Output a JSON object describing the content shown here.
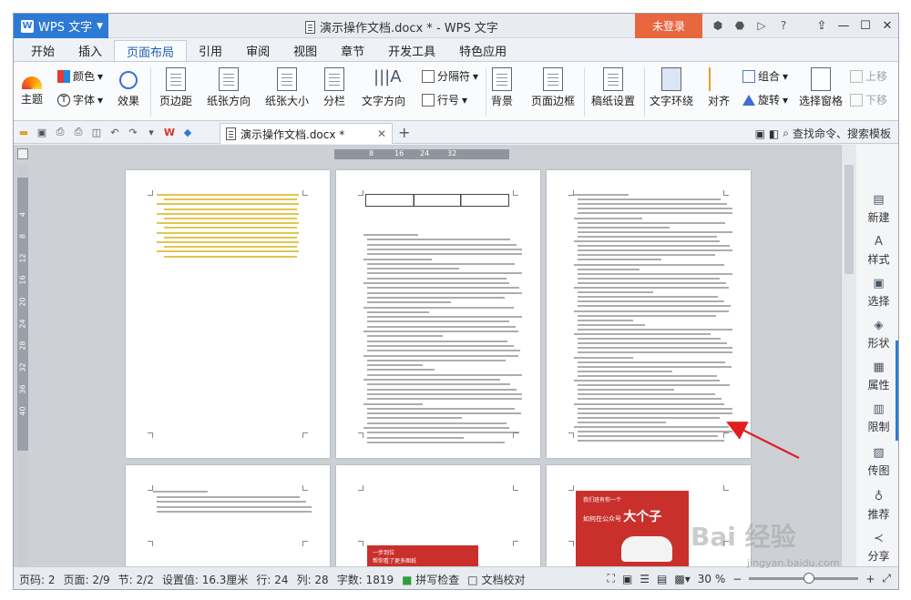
{
  "titlebar": {
    "app_name": "WPS 文字",
    "title": "演示操作文档.docx * - WPS 文字",
    "login": "未登录",
    "help": "?"
  },
  "menu": {
    "tabs": [
      "开始",
      "插入",
      "页面布局",
      "引用",
      "审阅",
      "视图",
      "章节",
      "开发工具",
      "特色应用"
    ],
    "active": "页面布局"
  },
  "ribbon": {
    "theme": "主题",
    "color": "颜色",
    "font": "字体",
    "effect": "效果",
    "margin": "页边距",
    "orientation": "纸张方向",
    "size": "纸张大小",
    "columns": "分栏",
    "text_direction": "文字方向",
    "break": "分隔符",
    "line_number": "行号",
    "background": "背景",
    "page_border": "页面边框",
    "manuscript": "稿纸设置",
    "wrap": "文字环绕",
    "align": "对齐",
    "rotate": "旋转",
    "group": "组合",
    "selection_pane": "选择窗格",
    "move_up": "上移",
    "move_down": "下移"
  },
  "tabs": {
    "doc_tab": "演示操作文档.docx *",
    "search": "查找命令、搜索模板"
  },
  "ruler": {
    "h_ticks": [
      "8",
      "16",
      "24",
      "32"
    ],
    "v_ticks": [
      "4",
      "8",
      "12",
      "16",
      "20",
      "24",
      "28",
      "32",
      "36",
      "40"
    ]
  },
  "sidebar": {
    "tools": [
      "新建",
      "样式",
      "选择",
      "形状",
      "属性",
      "限制",
      "传图",
      "推荐",
      "分享"
    ]
  },
  "page_content": {
    "page5_label": "一步到位",
    "page5_sub": "帮你看了更多图纸",
    "page6_title": "大个子",
    "page6_top": "我们班有你一个",
    "page6_mid": "如何在公众号"
  },
  "status": {
    "page_num": "页码: 2",
    "page": "页面: 2/9",
    "section": "节: 2/2",
    "setting": "设置值: 16.3厘米",
    "line": "行: 24",
    "col": "列: 28",
    "words": "字数: 1819",
    "spell": "拼写检查",
    "proof": "文档校对",
    "zoom": "30 %"
  },
  "watermark": {
    "brand": "Bai 经验",
    "url": "jingyan.baidu.com"
  },
  "colors": {
    "accent": "#2d7ad5",
    "login": "#e8673f",
    "arrow": "#e02020",
    "poster": "#c9302c"
  }
}
